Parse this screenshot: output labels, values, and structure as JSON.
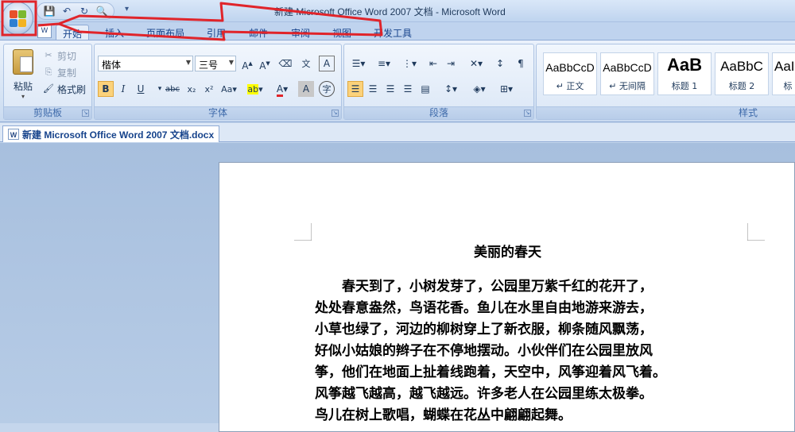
{
  "window": {
    "title": "新建 Microsoft Office Word 2007 文档 - Microsoft Word"
  },
  "tabs": [
    {
      "label": "开始",
      "active": true
    },
    {
      "label": "插入"
    },
    {
      "label": "页面布局"
    },
    {
      "label": "引用"
    },
    {
      "label": "邮件"
    },
    {
      "label": "审阅"
    },
    {
      "label": "视图"
    },
    {
      "label": "开发工具"
    }
  ],
  "clipboard": {
    "paste": "粘贴",
    "cut": "剪切",
    "copy": "复制",
    "format_painter": "格式刷",
    "group_label": "剪贴板"
  },
  "font": {
    "name": "楷体",
    "size": "三号",
    "group_label": "字体"
  },
  "paragraph": {
    "group_label": "段落"
  },
  "styles": {
    "group_label": "样式",
    "items": [
      {
        "sample": "AaBbCcD",
        "name": "↵ 正文"
      },
      {
        "sample": "AaBbCcD",
        "name": "↵ 无间隔"
      },
      {
        "sample": "AaB",
        "name": "标题 1"
      },
      {
        "sample": "AaBbC",
        "name": "标题 2"
      },
      {
        "sample": "AaI",
        "name": "标"
      }
    ]
  },
  "document": {
    "tab_label": "新建 Microsoft Office Word 2007 文档.docx",
    "title": "美丽的春天",
    "lines": [
      "　　春天到了，小树发芽了，公园里万紫千红的花开了，",
      "处处春意盎然，鸟语花香。鱼儿在水里自由地游来游去，",
      "小草也绿了，河边的柳树穿上了新衣服，柳条随风飘荡，",
      "好似小姑娘的辫子在不停地摆动。小伙伴们在公园里放风",
      "筝，他们在地面上扯着线跑着，天空中，风筝迎着风飞着。",
      "风筝越飞越高，越飞越远。许多老人在公园里练太极拳。",
      "鸟儿在树上歌唱，蝴蝶在花丛中翩翩起舞。"
    ]
  },
  "colors": {
    "annotation": "#e0242a",
    "ribbon_text": "#15428b"
  }
}
